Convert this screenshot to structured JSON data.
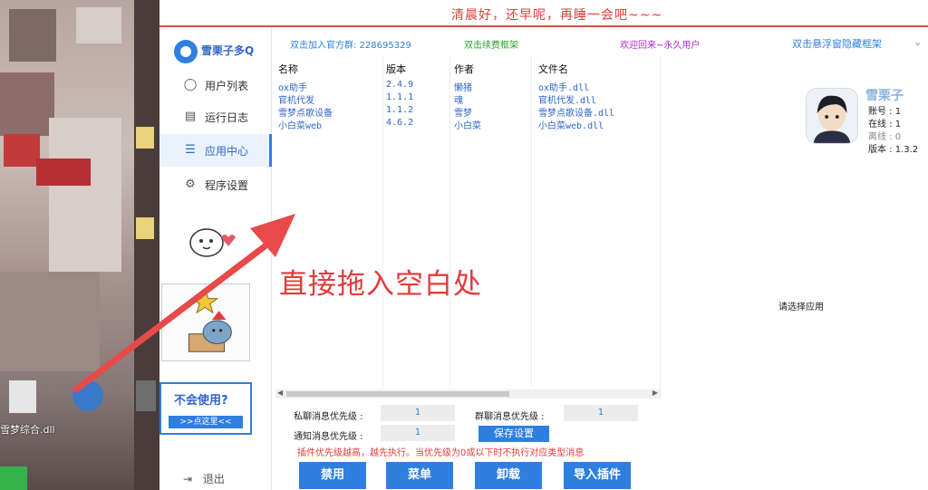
{
  "desktop": {
    "file_label": "雪梦综合.dll"
  },
  "topbar": {
    "message": "清晨好，还早呢，再睡一会吧~~~"
  },
  "sidebar": {
    "brand": "雪栗子多Q",
    "items": [
      {
        "label": "用户列表",
        "icon": "user-icon"
      },
      {
        "label": "运行日志",
        "icon": "document-icon"
      },
      {
        "label": "应用中心",
        "icon": "list-icon",
        "active": true
      },
      {
        "label": "程序设置",
        "icon": "gear-icon"
      }
    ],
    "help_title": "不会使用?",
    "help_button": ">>点这里<<",
    "logout": "退出"
  },
  "header": {
    "group": "双击加入官方群: 228695329",
    "renew": "双击续费框架",
    "welcome": "欢迎回来~永久用户",
    "hide": "双击悬浮窗隐藏框架"
  },
  "plugins": {
    "columns": [
      "名称",
      "版本",
      "作者",
      "文件名"
    ],
    "rows": [
      [
        "ox助手",
        "2.4.9",
        "懒猪",
        "ox助手.dll"
      ],
      [
        "官机代发",
        "1.1.1",
        "魂",
        "官机代发.dll"
      ],
      [
        "雪梦点歌设备",
        "1.1.2",
        "雪梦",
        "雪梦点歌设备.dll"
      ],
      [
        "小白菜web",
        "4.6.2",
        "小白菜",
        "小白菜web.dll"
      ]
    ]
  },
  "profile": {
    "name": "雪栗子",
    "account": "账号 : 1",
    "online": "在线 : 1",
    "offline": "离线 : 0",
    "version": "版本 : 1.3.2"
  },
  "right_panel": {
    "select_msg": "请选择应用"
  },
  "settings": {
    "private_label": "私聊消息优先级 :",
    "private_value": "1",
    "group_label": "群聊消息优先级 :",
    "group_value": "1",
    "notify_label": "通知消息优先级 :",
    "notify_value": "1",
    "save": "保存设置",
    "hint": "插件优先级越高，越先执行。当优先级为0或以下时不执行对应类型消息"
  },
  "actions": [
    "禁用",
    "菜单",
    "卸载",
    "导入插件"
  ],
  "annotation": {
    "text": "直接拖入空白处"
  }
}
